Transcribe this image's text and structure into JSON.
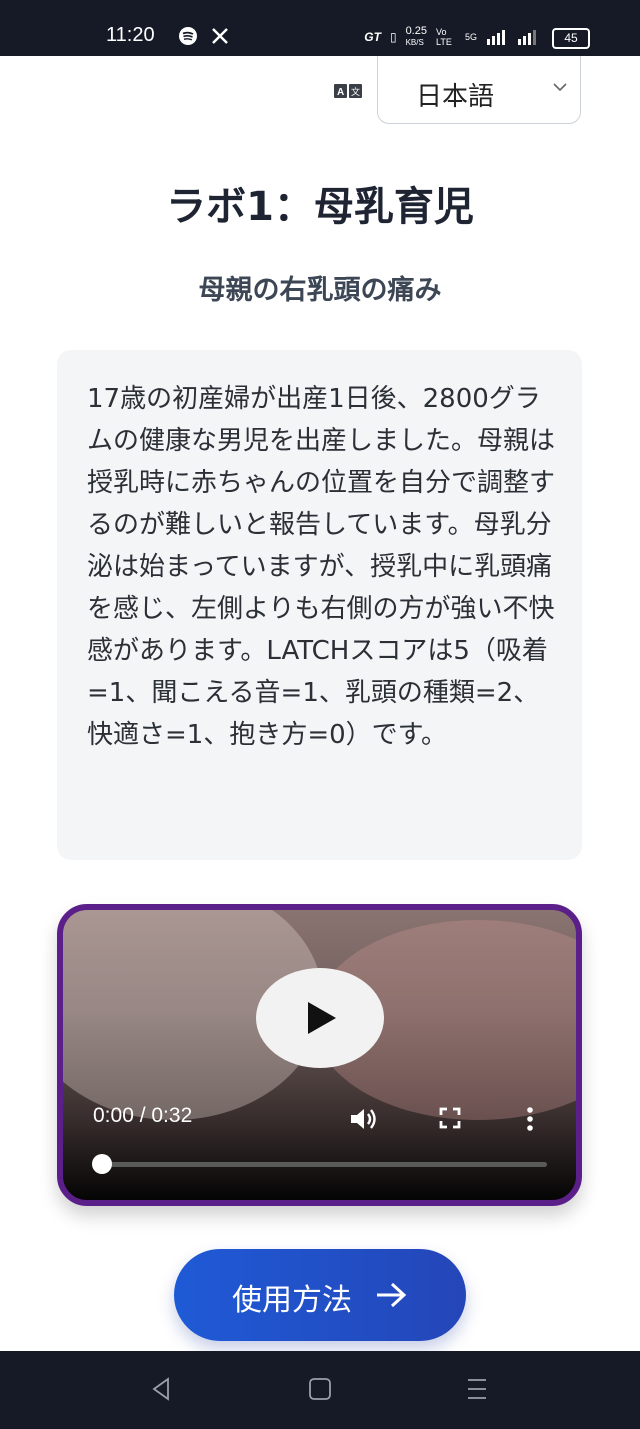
{
  "status_bar": {
    "time": "11:20",
    "network_speed_value": "0.25",
    "network_speed_unit": "KB/S",
    "volte": "Vo LTE",
    "network_type": "5G",
    "battery": "45"
  },
  "language": {
    "selected": "日本語"
  },
  "page": {
    "title": "ラボ1：母乳育児",
    "subtitle": "母親の右乳頭の痛み",
    "case_text": "17歳の初産婦が出産1日後、2800グラムの健康な男児を出産しました。母親は授乳時に赤ちゃんの位置を自分で調整するのが難しいと報告しています。母乳分泌は始まっていますが、授乳中に乳頭痛を感じ、左側よりも右側の方が強い不快感があります。LATCHスコアは5（吸着=1、聞こえる音=1、乳頭の種類=2、快適さ=1、抱き方=0）です。"
  },
  "video": {
    "time_display": "0:00 / 0:32",
    "progress": 0.0
  },
  "help_button": {
    "label": "使用方法"
  },
  "colors": {
    "video_border": "#5b1f8a",
    "button_start": "#1f5ad6",
    "button_end": "#2446b8",
    "status_bar_bg": "#161a26"
  }
}
